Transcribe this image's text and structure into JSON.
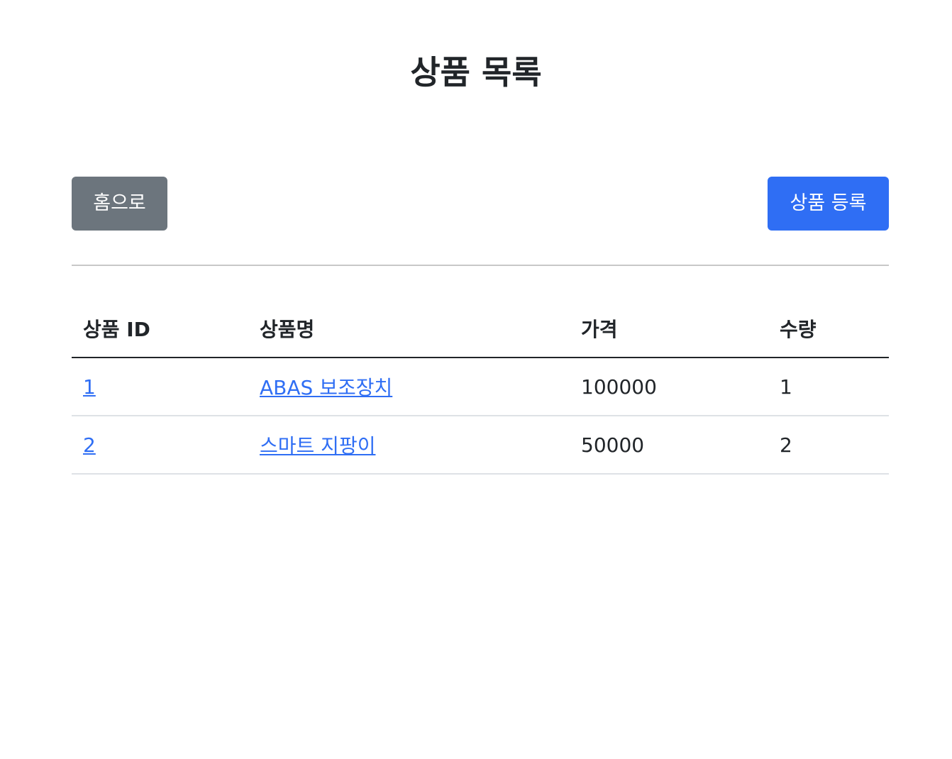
{
  "page": {
    "title": "상품 목록"
  },
  "toolbar": {
    "home_label": "홈으로",
    "register_label": "상품 등록"
  },
  "table": {
    "headers": [
      "상품 ID",
      "상품명",
      "가격",
      "수량"
    ],
    "rows": [
      {
        "id": "1",
        "name": "ABAS 보조장치",
        "price": "100000",
        "quantity": "1"
      },
      {
        "id": "2",
        "name": "스마트 지팡이",
        "price": "50000",
        "quantity": "2"
      }
    ]
  },
  "colors": {
    "primary": "#2f6ef4",
    "secondary": "#6c757d",
    "text": "#212529",
    "divider": "#c8c8c8",
    "row_border": "#dee2e6"
  }
}
